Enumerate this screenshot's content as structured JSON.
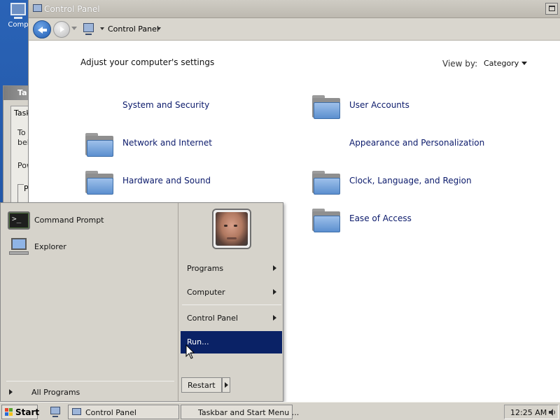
{
  "desktop": {
    "icon_label": "Comp"
  },
  "background_window": {
    "title": "Ta",
    "tab": "Task",
    "line1": "To",
    "line2": "bel",
    "line3": "Pow",
    "line4": "P"
  },
  "control_panel": {
    "title": "Control Panel",
    "address": "Control Panel",
    "heading": "Adjust your computer's settings",
    "view_by_label": "View by:",
    "view_by_value": "Category",
    "categories": [
      {
        "label": "System and Security"
      },
      {
        "label": "User Accounts"
      },
      {
        "label": "Network and Internet"
      },
      {
        "label": "Appearance and Personalization"
      },
      {
        "label": "Hardware and Sound"
      },
      {
        "label": "Clock, Language, and Region"
      },
      {
        "label": "Ease of Access"
      }
    ]
  },
  "start_menu": {
    "pinned": [
      {
        "label": "Command Prompt",
        "icon": "command-prompt-icon"
      },
      {
        "label": "Explorer",
        "icon": "computer-icon"
      }
    ],
    "all_programs": "All Programs",
    "right_items": [
      {
        "label": "Programs"
      },
      {
        "label": "Computer"
      },
      {
        "label": "Control Panel"
      },
      {
        "label": "Run..."
      }
    ],
    "restart": "Restart"
  },
  "taskbar": {
    "start": "Start",
    "tasks": [
      {
        "label": "Control Panel"
      },
      {
        "label": "Taskbar and Start Menu ..."
      }
    ],
    "clock": "12:25 AM"
  },
  "colors": {
    "desktop": "#2a63b6",
    "highlight": "#0a2266",
    "link": "#0b1a6b",
    "chrome": "#d6d3cb"
  }
}
